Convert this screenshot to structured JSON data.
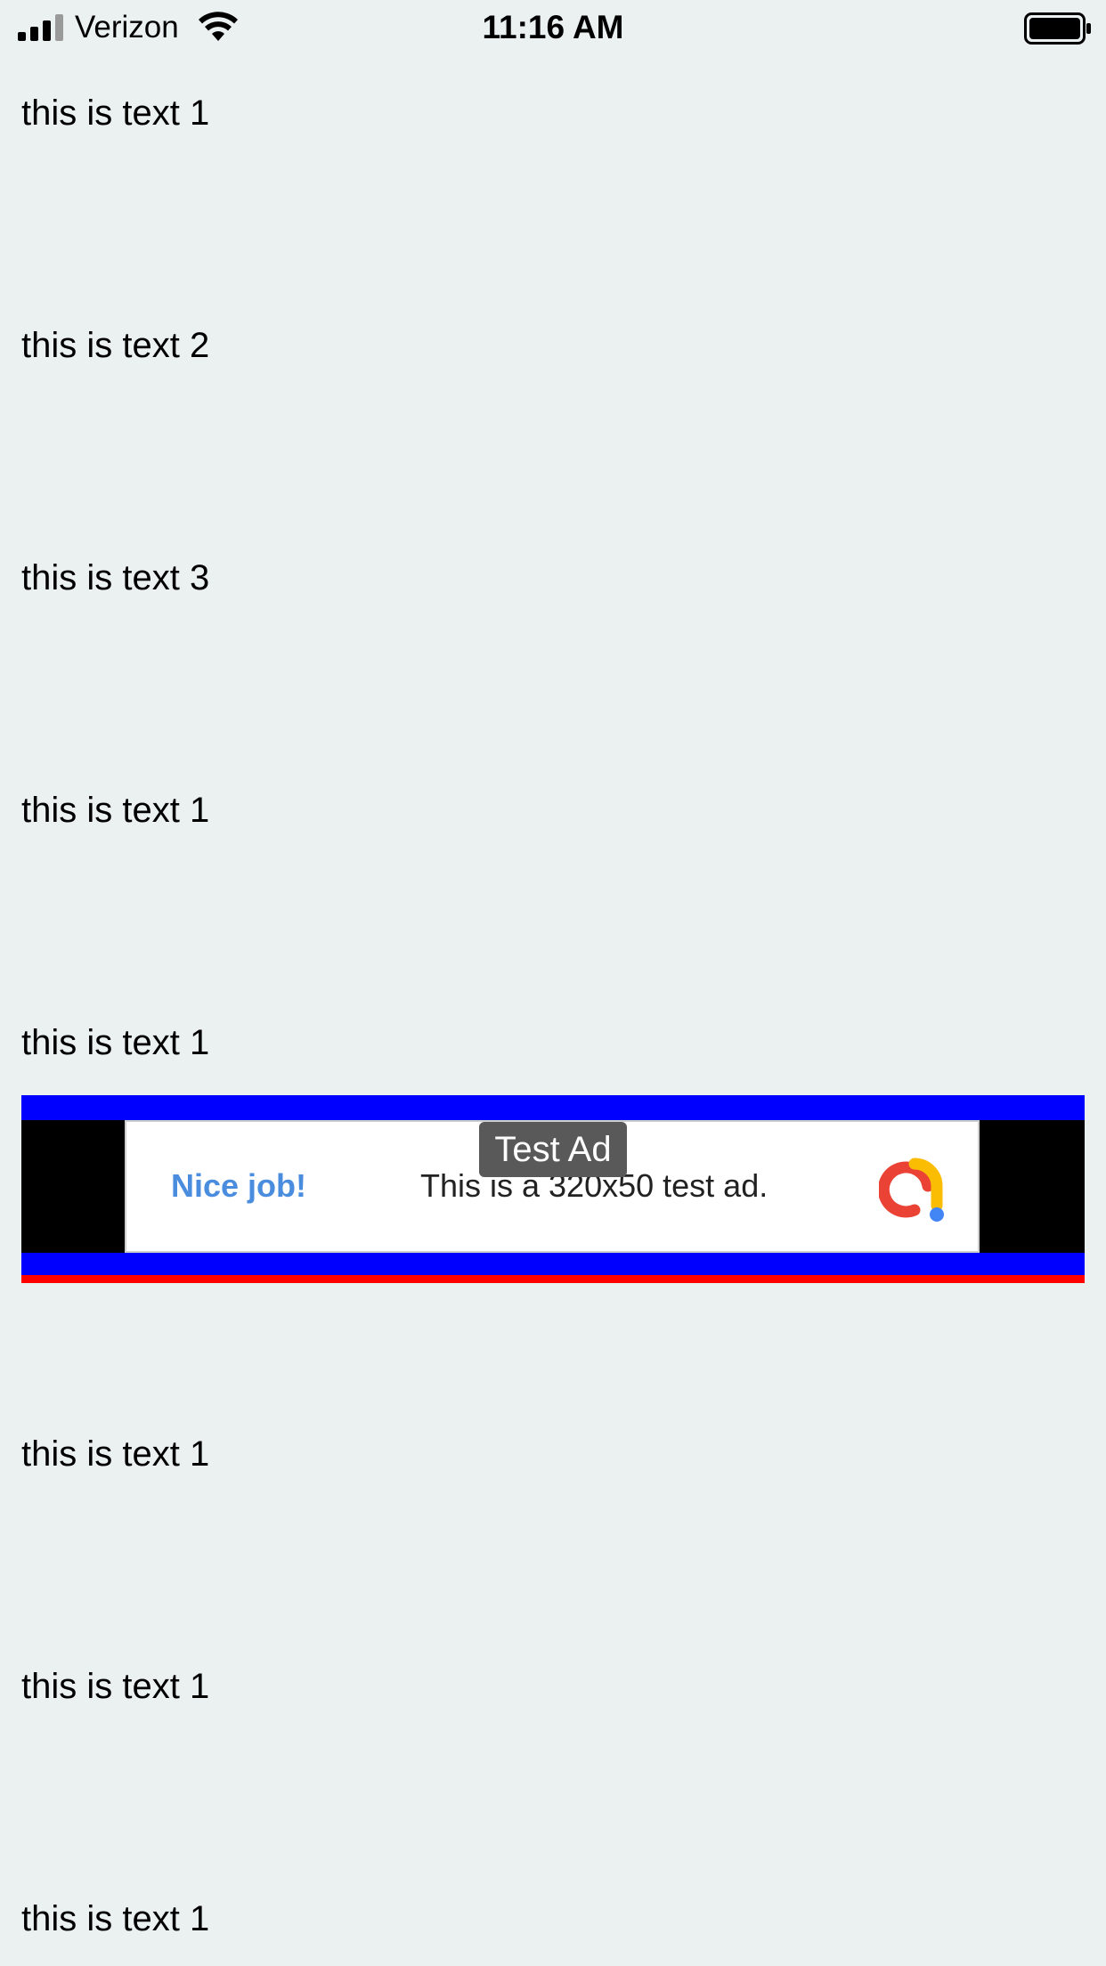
{
  "status_bar": {
    "carrier": "Verizon",
    "time": "11:16 AM",
    "signal_icon": "signal-bars-icon",
    "wifi_icon": "wifi-icon",
    "battery_icon": "battery-icon"
  },
  "rows": [
    "this is text 1",
    "this is text 2",
    "this is text 3",
    "this is text 1",
    "this is text 1",
    "this is text 1",
    "this is text 1",
    "this is text 1"
  ],
  "ad": {
    "badge": "Test Ad",
    "headline": "Nice job!",
    "body": "This is a 320x50 test ad.",
    "logo_icon": "ad-logo-icon",
    "colors": {
      "frame_blue": "#0000ff",
      "frame_red": "#ff0000",
      "headline_blue": "#4a8cde"
    }
  }
}
